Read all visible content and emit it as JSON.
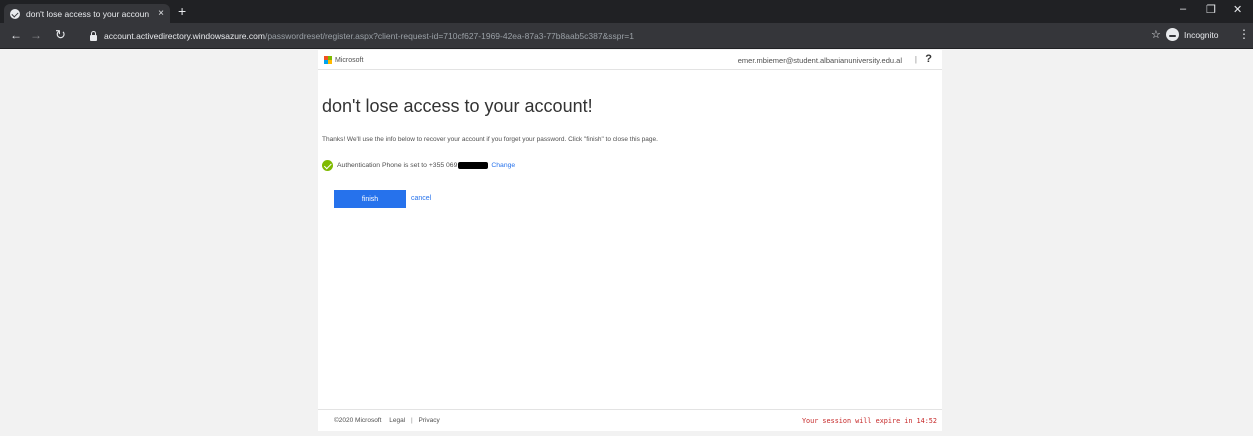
{
  "browser": {
    "tab_title": "don't lose access to your accoun",
    "tab_close": "×",
    "new_tab": "+",
    "url_domain": "account.activedirectory.windowsazure.com",
    "url_path": "/passwordreset/register.aspx?client-request-id=710cf627-1969-42ea-87a3-77b8aab5c387&sspr=1",
    "incognito_label": "Incognito",
    "icons": [
      "back-icon",
      "forward-icon",
      "reload-icon",
      "lock-icon",
      "star-icon",
      "incognito-icon",
      "menu-icon"
    ]
  },
  "header": {
    "brand": "Microsoft",
    "user_email": "emer.mbiemer@student.albanianuniversity.edu.al",
    "separator": "|",
    "help": "?"
  },
  "main": {
    "title": "don't lose access to your account!",
    "intro": "Thanks! We'll use the info below to recover your account if you forget your password. Click \"finish\" to close this page.",
    "auth_text": "Authentication Phone is set to +355 069",
    "change_link": "Change",
    "finish_label": "finish",
    "cancel_label": "cancel"
  },
  "footer": {
    "copyright": "©2020 Microsoft",
    "legal": "Legal",
    "separator": "|",
    "privacy": "Privacy",
    "session_message": "Your session will expire in 14:52"
  },
  "colors": {
    "accent": "#2672ec",
    "success": "#7fba00",
    "warning_text": "#c62828",
    "ms_red": "#f25022",
    "ms_green": "#7fba00",
    "ms_blue": "#00a4ef",
    "ms_yellow": "#ffb900"
  }
}
